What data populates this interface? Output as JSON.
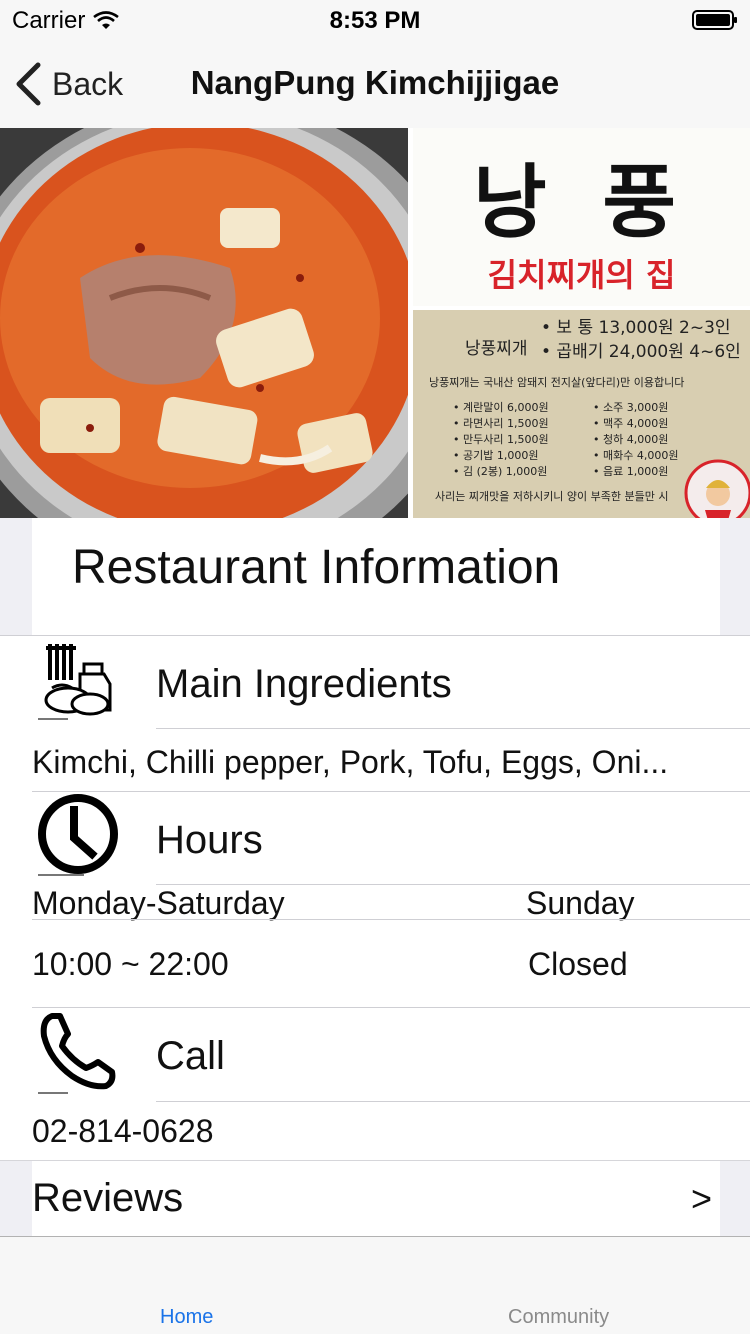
{
  "status_bar": {
    "carrier": "Carrier",
    "time": "8:53 PM"
  },
  "nav": {
    "back_label": "Back",
    "title": "NangPung Kimchijjigae"
  },
  "sign": {
    "name_korean": "낭 풍",
    "subtitle_korean": "김치찌개의 집"
  },
  "menu_board": {
    "main_item": "낭풍찌개",
    "prices": [
      "• 보 통  13,000원 2~3인",
      "• 곱배기  24,000원 4~6인"
    ],
    "notice": "낭풍찌개는 국내산 암돼지 전지살(앞다리)만 이용합니다",
    "left_items": [
      "• 계란말이  6,000원",
      "• 라면사리  1,500원",
      "• 만두사리  1,500원",
      "• 공기밥  1,000원",
      "• 김 (2봉)  1,000원"
    ],
    "right_items": [
      "• 소주  3,000원",
      "• 맥주  4,000원",
      "• 청하  4,000원",
      "• 매화수  4,000원",
      "• 음료  1,000원"
    ],
    "footer": "사리는 찌개맛을 저하시키니 양이 부족한 분들만 시"
  },
  "info": {
    "section_title": "Restaurant Information",
    "ingredients": {
      "label": "Main Ingredients",
      "value": "Kimchi, Chilli pepper, Pork, Tofu, Eggs, Oni..."
    },
    "hours": {
      "label": "Hours",
      "weekday_header": "Monday-Saturday",
      "weekend_header": "Sunday",
      "weekday_value": "10:00 ~ 22:00",
      "weekend_value": "Closed"
    },
    "call": {
      "label": "Call",
      "phone": "02-814-0628"
    },
    "reviews": {
      "label": "Reviews",
      "chevron": ">"
    }
  },
  "tabs": {
    "home": "Home",
    "community": "Community"
  },
  "colors": {
    "tab_active": "#1a73e8",
    "tab_inactive": "#8a8a8a",
    "background_grey": "#efeff4",
    "sign_red": "#d8232a"
  }
}
